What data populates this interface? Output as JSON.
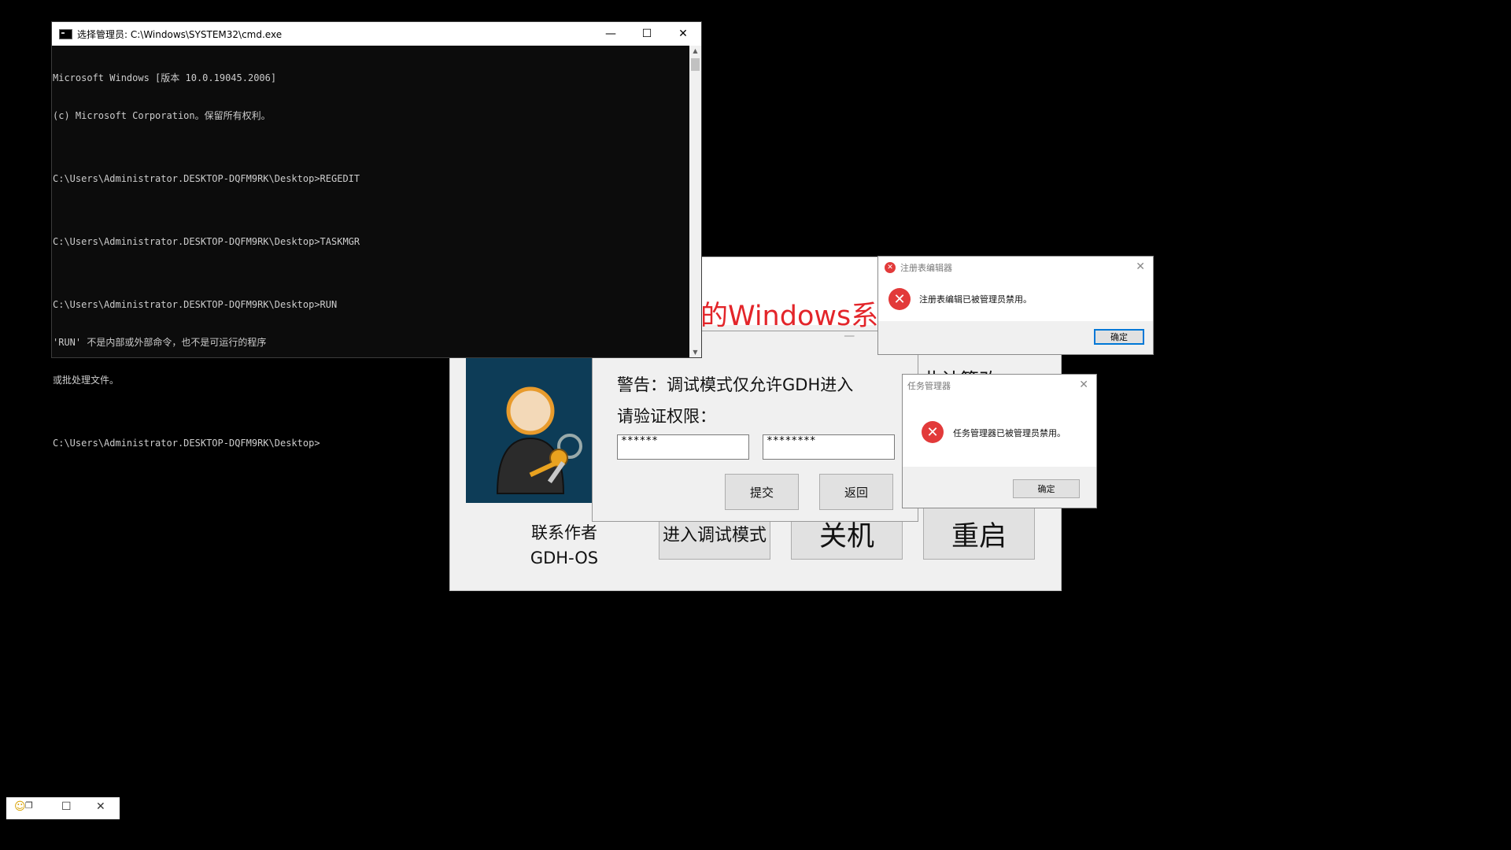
{
  "cmd": {
    "title": "选择管理员: C:\\Windows\\SYSTEM32\\cmd.exe",
    "controls": {
      "minimize": "—",
      "maximize": "☐",
      "close": "✕"
    },
    "lines": [
      "Microsoft Windows [版本 10.0.19045.2006]",
      "(c) Microsoft Corporation。保留所有权利。",
      "",
      "C:\\Users\\Administrator.DESKTOP-DQFM9RK\\Desktop>REGEDIT",
      "",
      "C:\\Users\\Administrator.DESKTOP-DQFM9RK\\Desktop>TASKMGR",
      "",
      "C:\\Users\\Administrator.DESKTOP-DQFM9RK\\Desktop>RUN",
      "'RUN' 不是内部或外部命令，也不是可运行的程序",
      "或批处理文件。",
      "",
      "C:\\Users\\Administrator.DESKTOP-DQFM9RK\\Desktop>"
    ]
  },
  "main": {
    "title_fragment": "的Windows系统",
    "subtext_fragment": "此计算改",
    "contact_line1": "联系作者",
    "contact_line2": "GDH-OS",
    "buttons": {
      "debug": "进入调试模式",
      "shutdown": "关机",
      "restart": "重启"
    }
  },
  "auth": {
    "warning": "警告：调试模式仅允许GDH进入",
    "prompt": "请验证权限：",
    "password1": "******",
    "password2": "********",
    "submit": "提交",
    "back": "返回"
  },
  "regedit_error": {
    "title": "注册表编辑器",
    "message": "注册表编辑已被管理员禁用。",
    "ok": "确定"
  },
  "taskmgr_error": {
    "title": "任务管理器",
    "message": "任务管理器已被管理员禁用。",
    "ok": "确定"
  },
  "colors": {
    "title_red": "#e3252a",
    "avatar_bg": "#0d3c57",
    "error_red": "#e23a3a",
    "focus_blue": "#0078d7"
  }
}
